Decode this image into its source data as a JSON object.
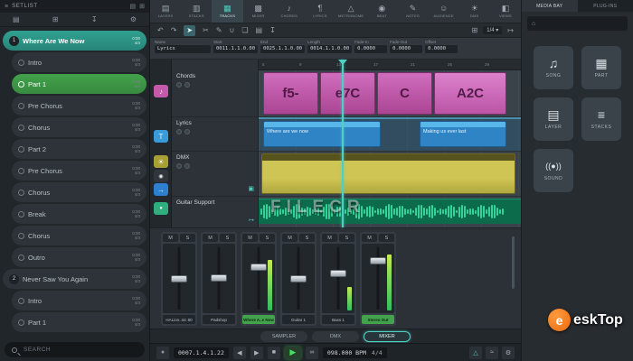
{
  "watermark": {
    "text": "FILECR"
  },
  "brand": {
    "logo_letter": "e",
    "logo_text": "eskTop"
  },
  "colors": {
    "accent": "#4fd0c2",
    "selected_teal": "#31a08f",
    "selected_green": "#43a24b",
    "chord_pink": "#c45aab",
    "lyrics_blue": "#3a9bd9",
    "dmx_yellow": "#cfc554",
    "wave_green": "#35d39a"
  },
  "sidebar_icons": {
    "menu": "≡",
    "panel_a": "▤",
    "panel_b": "⊞",
    "list": "▤",
    "grid": "⊞",
    "import": "↧",
    "gear": "⚙"
  },
  "setlist": {
    "title": "SETLIST",
    "search_placeholder": "SEARCH",
    "items": [
      {
        "num": "1",
        "label": "Where Are We Now",
        "dur": "0:00",
        "sig": "4/4"
      },
      {
        "label": "Intro",
        "dur": "0:00",
        "sig": "4/4"
      },
      {
        "label": "Part 1",
        "dur": "0:00",
        "sig": "4/4"
      },
      {
        "label": "Pre Chorus",
        "dur": "0:00",
        "sig": "4/4"
      },
      {
        "label": "Chorus",
        "dur": "0:00",
        "sig": "4/4"
      },
      {
        "label": "Part 2",
        "dur": "0:00",
        "sig": "4/4"
      },
      {
        "label": "Pre Chorus",
        "dur": "0:00",
        "sig": "4/4"
      },
      {
        "label": "Chorus",
        "dur": "0:00",
        "sig": "4/4"
      },
      {
        "label": "Break",
        "dur": "0:00",
        "sig": "4/4"
      },
      {
        "label": "Chorus",
        "dur": "0:00",
        "sig": "4/4"
      },
      {
        "label": "Outro",
        "dur": "0:00",
        "sig": "4/4"
      },
      {
        "num": "2",
        "label": "Never Saw You Again",
        "dur": "0:00",
        "sig": "4/4"
      },
      {
        "label": "Intro",
        "dur": "0:00",
        "sig": "4/4"
      },
      {
        "label": "Part 1",
        "dur": "0:00",
        "sig": "4/4"
      }
    ]
  },
  "main_tabs": [
    {
      "label": "LAYERS",
      "icon": "▤"
    },
    {
      "label": "STACKS",
      "icon": "▥"
    },
    {
      "label": "TRACKS",
      "icon": "▦"
    },
    {
      "label": "MIXER",
      "icon": "▩"
    },
    {
      "label": "CHORDS",
      "icon": "♪"
    },
    {
      "label": "LYRICS",
      "icon": "¶"
    },
    {
      "label": "METRONOME",
      "icon": "△"
    },
    {
      "label": "BEAT",
      "icon": "◉"
    },
    {
      "label": "NOTES",
      "icon": "✎"
    },
    {
      "label": "AUDIENCE",
      "icon": "☺"
    },
    {
      "label": "DMX",
      "icon": "☀"
    },
    {
      "label": "VIEWS",
      "icon": "◧"
    }
  ],
  "edit_tools": {
    "undo": "↶",
    "redo": "↷",
    "select": "➤",
    "split": "✂",
    "draw": "✎",
    "glue": "∪",
    "copy": "❏",
    "paste": "▤",
    "import": "↧",
    "grid": "⊞",
    "grid_value": "1/4",
    "caret": "▾",
    "goto": "↦"
  },
  "inspector": {
    "fields": [
      {
        "label": "Name",
        "value": "Lyrics"
      },
      {
        "label": "Start",
        "value": "0011.1.1.0.00"
      },
      {
        "label": "End",
        "value": "0025.1.1.0.00"
      },
      {
        "label": "Length",
        "value": "0014.1.1.0.00"
      },
      {
        "label": "Fade-In",
        "value": "0.0000"
      },
      {
        "label": "Fade-Out",
        "value": "0.0000"
      },
      {
        "label": "Offset",
        "value": "0.0000"
      }
    ]
  },
  "ruler": {
    "ticks": [
      "5",
      "9",
      "13",
      "17",
      "21",
      "25",
      "29"
    ]
  },
  "tracks": {
    "chords": {
      "name": "Chords",
      "icon": "♪",
      "events": [
        "f5-",
        "e7C",
        "C",
        "A2C"
      ]
    },
    "lyrics": {
      "name": "Lyrics",
      "icon": "T",
      "events": [
        "Where are we now",
        "Making us ever last"
      ]
    },
    "dmx": {
      "name": "DMX",
      "icon": "☀"
    },
    "guitar": {
      "name": "Guitar Support",
      "icon": "→"
    }
  },
  "track_icons": {
    "mic": "◉",
    "monitor": "▣",
    "output": "↦",
    "input_arrow": "→",
    "state": "●"
  },
  "mixer": {
    "mute": "M",
    "solo": "S",
    "channels": [
      {
        "name": "HALion..nic 80"
      },
      {
        "name": "Padshop"
      },
      {
        "name": "Where A..e Now"
      },
      {
        "name": "Guitar 1"
      },
      {
        "name": "Bass 1"
      },
      {
        "name": "Stereo Out"
      }
    ],
    "view_tabs": [
      "SAMPLER",
      "DMX",
      "MIXER"
    ]
  },
  "transport": {
    "position": "0007.1.4.1.22",
    "bpm": "098.000 BPM",
    "timesig": "4/4",
    "icons": {
      "record": "●",
      "prev": "◀",
      "next": "▶",
      "stop": "■",
      "play": "▶",
      "loop": "∞",
      "metronome": "△",
      "audio": "≈",
      "settings": "⚙"
    }
  },
  "media_bay": {
    "tabs": [
      "MEDIA BAY",
      "PLUG-INS"
    ],
    "home_icon": "⌂",
    "buttons": [
      {
        "label": "SONG",
        "icon": "♫"
      },
      {
        "label": "PART",
        "icon": "▦"
      },
      {
        "label": "LAYER",
        "icon": "▤"
      },
      {
        "label": "STACKS",
        "icon": "≡"
      },
      {
        "label": "SOUND",
        "icon": "((●))"
      }
    ]
  }
}
